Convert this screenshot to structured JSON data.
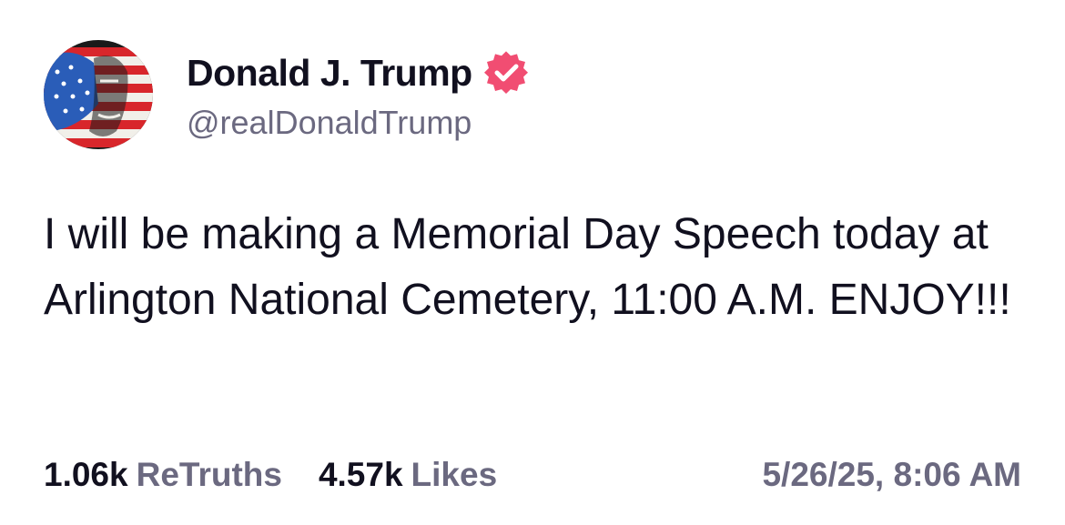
{
  "author": {
    "display_name": "Donald J. Trump",
    "handle": "@realDonaldTrump",
    "verified": true,
    "verified_badge_color": "#f14d72"
  },
  "post": {
    "text": "I will be making a Memorial Day Speech today at Arlington National Cemetery, 11:00 A.M. ENJOY!!!"
  },
  "stats": {
    "retruths_count": "1.06k",
    "retruths_label": "ReTruths",
    "likes_count": "4.57k",
    "likes_label": "Likes"
  },
  "timestamp": "5/26/25, 8:06 AM",
  "colors": {
    "primary_text": "#11101f",
    "secondary_text": "#6b6980",
    "background": "#ffffff"
  }
}
